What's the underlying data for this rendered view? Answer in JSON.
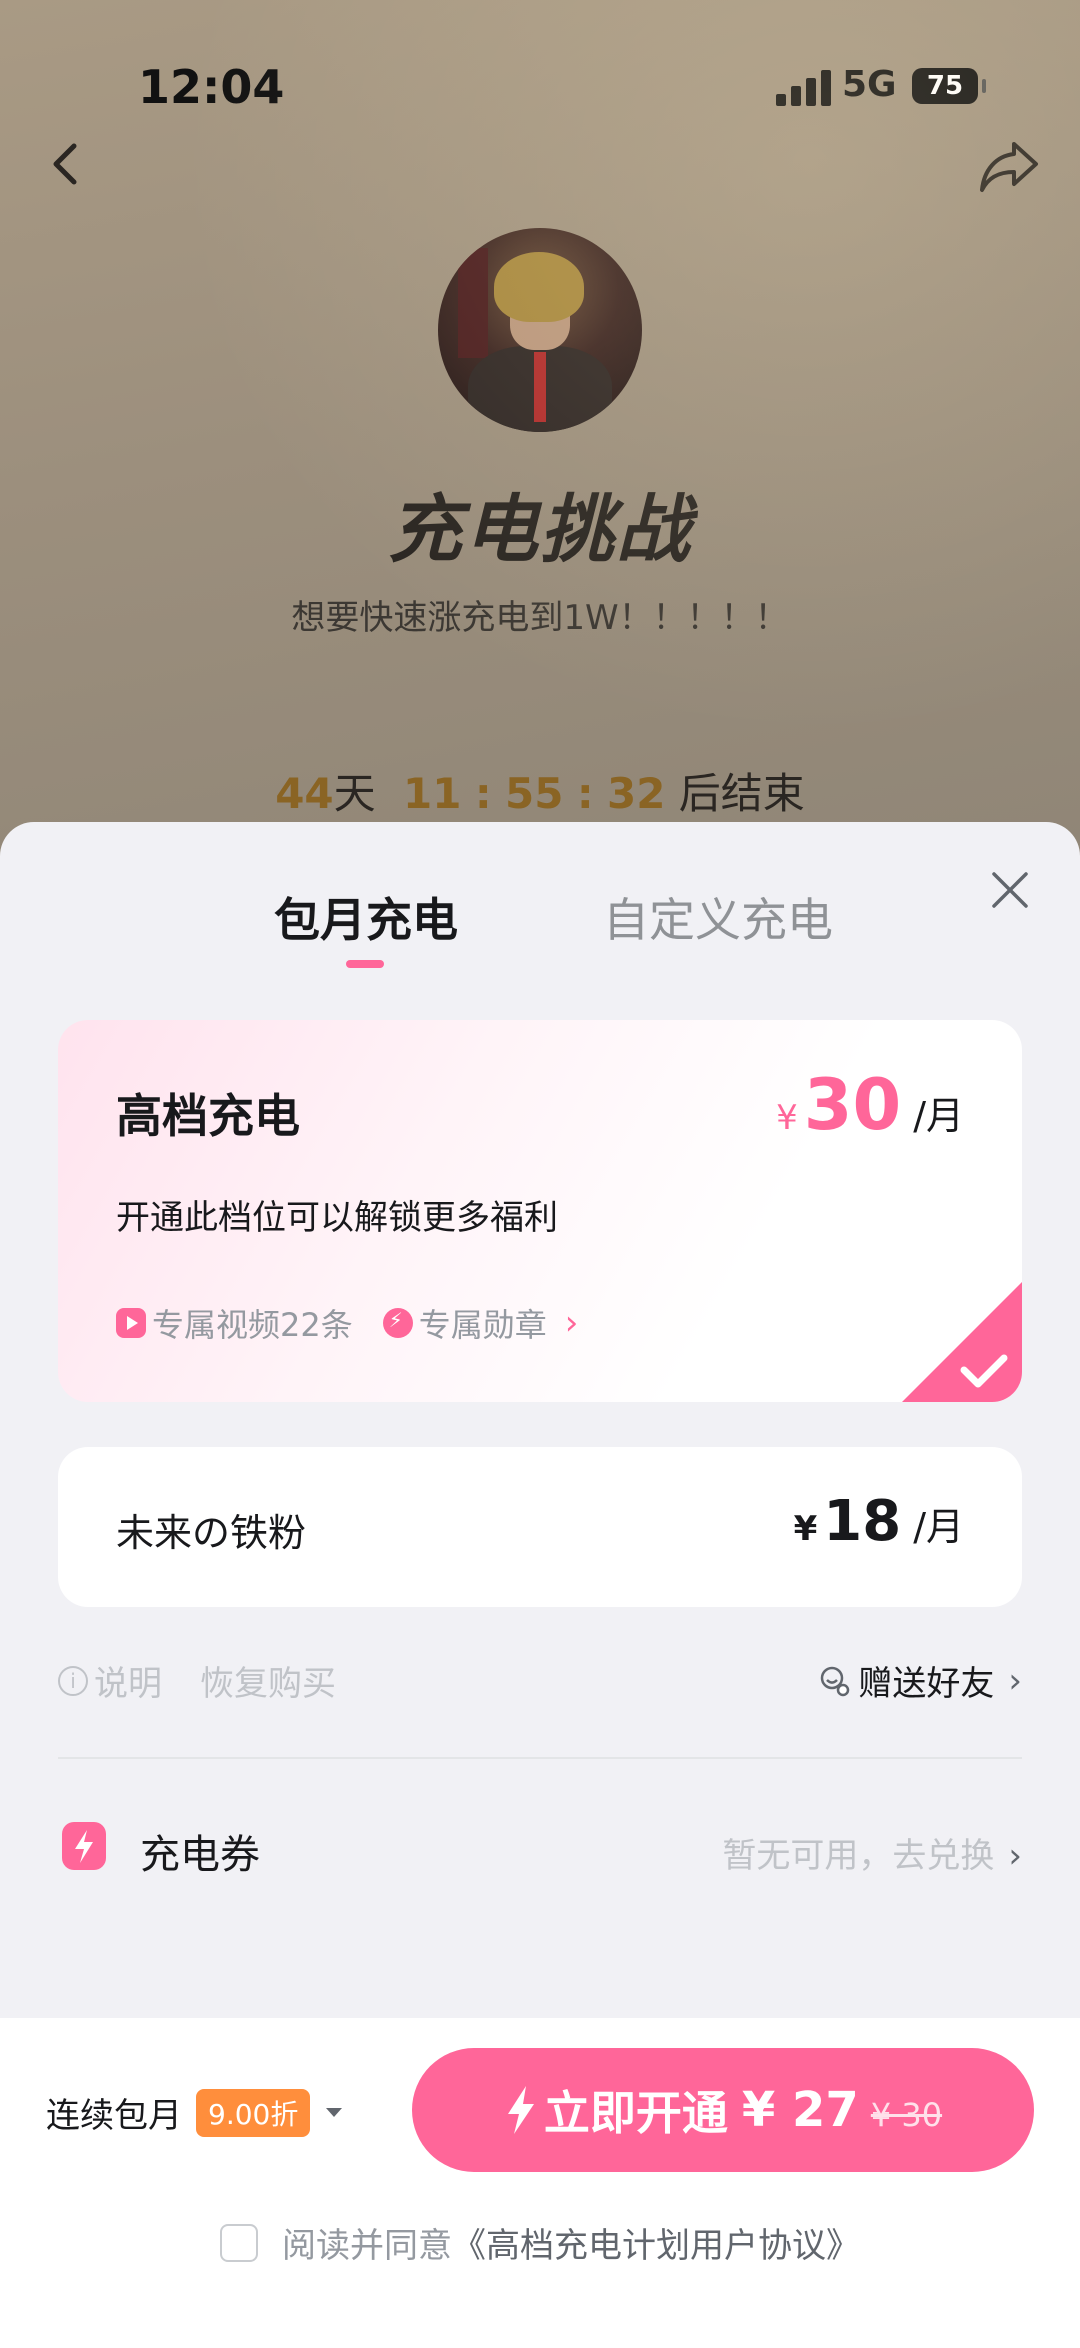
{
  "status_bar": {
    "time": "12:04",
    "network": "5G",
    "battery": "75"
  },
  "page": {
    "title": "充电挑战",
    "subtitle": "想要快速涨充电到1W！！！！！",
    "countdown": {
      "days": "44",
      "day_unit": "天",
      "hours": "11",
      "minutes": "55",
      "seconds": "32",
      "sep": ":",
      "suffix": "后结束"
    }
  },
  "sheet": {
    "tabs": [
      {
        "label": "包月充电",
        "active": true
      },
      {
        "label": "自定义充电",
        "active": false
      }
    ],
    "plans": [
      {
        "name": "高档充电",
        "currency": "¥",
        "price": "30",
        "unit": "/月",
        "description": "开通此档位可以解锁更多福利",
        "perks": [
          "专属视频22条",
          "专属勋章"
        ],
        "selected": true
      },
      {
        "name": "未来の铁粉",
        "currency": "¥",
        "price": "18",
        "unit": "/月",
        "selected": false
      }
    ],
    "links": {
      "info": "说明",
      "restore": "恢复购买",
      "gift": "赠送好友"
    },
    "voucher": {
      "label": "充电券",
      "status": "暂无可用，去兑换"
    }
  },
  "bottom": {
    "renew_label": "连续包月",
    "discount": "9.00折",
    "cta_label": "立即开通",
    "cta_price": "¥ 27",
    "cta_original": "¥ 30",
    "agreement_prefix": "阅读并同意",
    "agreement_link": "《高档充电计划用户协议》"
  },
  "colors": {
    "accent": "#ff6699",
    "discount": "#ff8e3c",
    "countdown": "#8a6424"
  }
}
